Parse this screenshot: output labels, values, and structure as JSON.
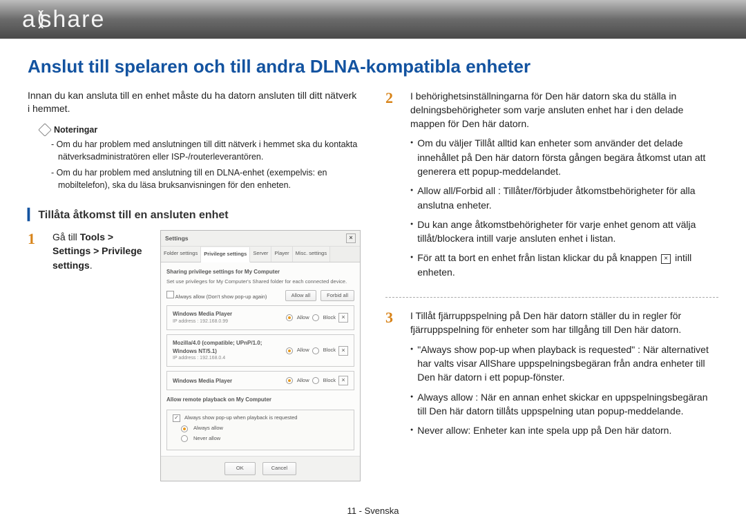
{
  "logo": {
    "left": "a",
    "right": "share"
  },
  "title": "Anslut till spelaren och till andra DLNA-kompatibla enheter",
  "intro": "Innan du kan ansluta till en enhet måste du ha datorn ansluten till ditt nätverk i hemmet.",
  "notes_label": "Noteringar",
  "notes": [
    "Om du har problem med anslutningen till ditt nätverk i hemmet ska du kontakta nätverksadministratören eller ISP-/routerleverantören.",
    "Om du har problem med anslutning till en DLNA-enhet (exempelvis: en mobiltelefon), ska du läsa bruksanvisningen för den enheten."
  ],
  "section_title": "Tillåta åtkomst till en ansluten enhet",
  "step1": {
    "prefix": "Gå till ",
    "path": "Tools > Settings > Privilege settings",
    "suffix": "."
  },
  "step2": {
    "text": "I behörighetsinställningarna för Den här datorn ska du ställa in delningsbehörigheter som varje ansluten enhet har i den delade mappen för Den här datorn.",
    "bullets": [
      "Om du väljer Tillåt alltid kan enheter som använder det delade innehållet på Den här datorn första gången begära åtkomst utan att generera ett popup-meddelandet.",
      "Allow all/Forbid all : Tillåter/förbjuder åtkomstbehörigheter för alla anslutna enheter.",
      "Du kan ange åtkomstbehörigheter för varje enhet genom att välja tillåt/blockera intill varje ansluten enhet i listan."
    ],
    "bullet4_before": "För att ta bort en enhet från listan klickar du på knappen ",
    "bullet4_after": " intill enheten."
  },
  "step3": {
    "text": "I Tillåt fjärruppspelning på Den här datorn ställer du in regler för fjärruppspelning för enheter som har tillgång till Den här datorn.",
    "bullets": [
      "\"Always show pop-up when playback is requested\" : När alternativet har valts visar AllShare uppspelningsbegäran från andra enheter till Den här datorn i ett popup-fönster.",
      "Always allow : När en annan enhet skickar en uppspelningsbegäran till Den här datorn tillåts uppspelning utan popup-meddelande.",
      "Never allow: Enheter kan inte spela upp på Den här datorn."
    ]
  },
  "dialog": {
    "title": "Settings",
    "tabs": [
      "Folder settings",
      "Privilege settings",
      "Server",
      "Player",
      "Misc. settings"
    ],
    "heading": "Sharing privilege settings for My Computer",
    "sub": "Set use privileges for My Computer's Shared folder for each connected device.",
    "always_allow_chk": "Always allow (Don't show pop-up again)",
    "allow_all": "Allow all",
    "forbid_all": "Forbid all",
    "allow": "Allow",
    "block": "Block",
    "devices": [
      {
        "name": "Windows Media Player",
        "sub": "IP address : 192.168.0.99"
      },
      {
        "name": "Mozilla/4.0 (compatible; UPnP/1.0; Windows NT/5.1)",
        "sub": "IP address : 192.168.0.4"
      },
      {
        "name": "Windows Media Player",
        "sub": ""
      }
    ],
    "section2_title": "Allow remote playback on My Computer",
    "opt_popup": "Always show pop-up when playback is requested",
    "opt_always": "Always allow",
    "opt_never": "Never allow",
    "ok": "OK",
    "cancel": "Cancel"
  },
  "footer": "11 - Svenska"
}
